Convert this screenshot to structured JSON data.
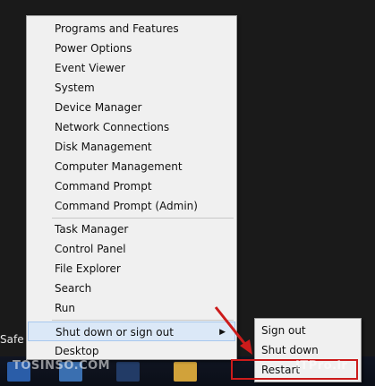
{
  "desktop": {
    "side_text": "Safe"
  },
  "menu": {
    "groups": [
      [
        "Programs and Features",
        "Power Options",
        "Event Viewer",
        "System",
        "Device Manager",
        "Network Connections",
        "Disk Management",
        "Computer Management",
        "Command Prompt",
        "Command Prompt (Admin)"
      ],
      [
        "Task Manager",
        "Control Panel",
        "File Explorer",
        "Search",
        "Run"
      ],
      [
        "Shut down or sign out",
        "Desktop"
      ]
    ]
  },
  "submenu": {
    "items": [
      "Sign out",
      "Shut down",
      "Restart"
    ]
  },
  "watermarks": {
    "left": "TOSINSO.COM",
    "right": "ITPro.ir"
  },
  "colors": {
    "highlight": "#dbe8f7",
    "annotation": "#cc1b1b"
  }
}
